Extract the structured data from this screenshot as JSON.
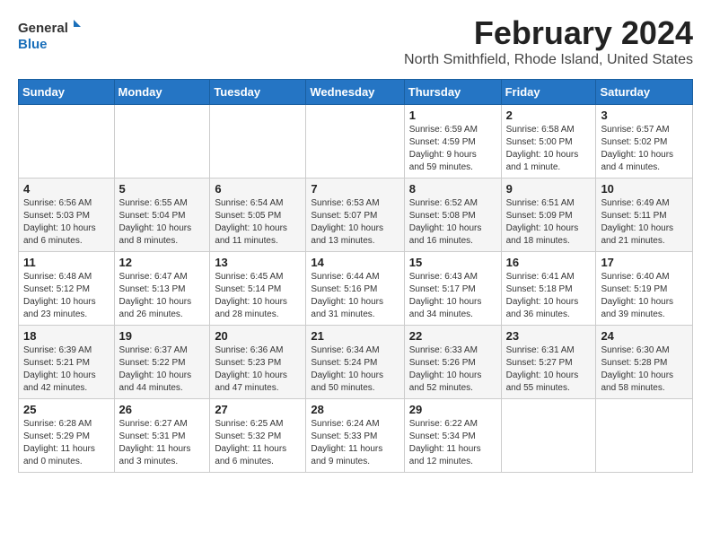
{
  "app": {
    "logo_line1": "General",
    "logo_line2": "Blue"
  },
  "header": {
    "month_year": "February 2024",
    "location": "North Smithfield, Rhode Island, United States"
  },
  "weekdays": [
    "Sunday",
    "Monday",
    "Tuesday",
    "Wednesday",
    "Thursday",
    "Friday",
    "Saturday"
  ],
  "weeks": [
    [
      {
        "day": "",
        "info": ""
      },
      {
        "day": "",
        "info": ""
      },
      {
        "day": "",
        "info": ""
      },
      {
        "day": "",
        "info": ""
      },
      {
        "day": "1",
        "info": "Sunrise: 6:59 AM\nSunset: 4:59 PM\nDaylight: 9 hours\nand 59 minutes."
      },
      {
        "day": "2",
        "info": "Sunrise: 6:58 AM\nSunset: 5:00 PM\nDaylight: 10 hours\nand 1 minute."
      },
      {
        "day": "3",
        "info": "Sunrise: 6:57 AM\nSunset: 5:02 PM\nDaylight: 10 hours\nand 4 minutes."
      }
    ],
    [
      {
        "day": "4",
        "info": "Sunrise: 6:56 AM\nSunset: 5:03 PM\nDaylight: 10 hours\nand 6 minutes."
      },
      {
        "day": "5",
        "info": "Sunrise: 6:55 AM\nSunset: 5:04 PM\nDaylight: 10 hours\nand 8 minutes."
      },
      {
        "day": "6",
        "info": "Sunrise: 6:54 AM\nSunset: 5:05 PM\nDaylight: 10 hours\nand 11 minutes."
      },
      {
        "day": "7",
        "info": "Sunrise: 6:53 AM\nSunset: 5:07 PM\nDaylight: 10 hours\nand 13 minutes."
      },
      {
        "day": "8",
        "info": "Sunrise: 6:52 AM\nSunset: 5:08 PM\nDaylight: 10 hours\nand 16 minutes."
      },
      {
        "day": "9",
        "info": "Sunrise: 6:51 AM\nSunset: 5:09 PM\nDaylight: 10 hours\nand 18 minutes."
      },
      {
        "day": "10",
        "info": "Sunrise: 6:49 AM\nSunset: 5:11 PM\nDaylight: 10 hours\nand 21 minutes."
      }
    ],
    [
      {
        "day": "11",
        "info": "Sunrise: 6:48 AM\nSunset: 5:12 PM\nDaylight: 10 hours\nand 23 minutes."
      },
      {
        "day": "12",
        "info": "Sunrise: 6:47 AM\nSunset: 5:13 PM\nDaylight: 10 hours\nand 26 minutes."
      },
      {
        "day": "13",
        "info": "Sunrise: 6:45 AM\nSunset: 5:14 PM\nDaylight: 10 hours\nand 28 minutes."
      },
      {
        "day": "14",
        "info": "Sunrise: 6:44 AM\nSunset: 5:16 PM\nDaylight: 10 hours\nand 31 minutes."
      },
      {
        "day": "15",
        "info": "Sunrise: 6:43 AM\nSunset: 5:17 PM\nDaylight: 10 hours\nand 34 minutes."
      },
      {
        "day": "16",
        "info": "Sunrise: 6:41 AM\nSunset: 5:18 PM\nDaylight: 10 hours\nand 36 minutes."
      },
      {
        "day": "17",
        "info": "Sunrise: 6:40 AM\nSunset: 5:19 PM\nDaylight: 10 hours\nand 39 minutes."
      }
    ],
    [
      {
        "day": "18",
        "info": "Sunrise: 6:39 AM\nSunset: 5:21 PM\nDaylight: 10 hours\nand 42 minutes."
      },
      {
        "day": "19",
        "info": "Sunrise: 6:37 AM\nSunset: 5:22 PM\nDaylight: 10 hours\nand 44 minutes."
      },
      {
        "day": "20",
        "info": "Sunrise: 6:36 AM\nSunset: 5:23 PM\nDaylight: 10 hours\nand 47 minutes."
      },
      {
        "day": "21",
        "info": "Sunrise: 6:34 AM\nSunset: 5:24 PM\nDaylight: 10 hours\nand 50 minutes."
      },
      {
        "day": "22",
        "info": "Sunrise: 6:33 AM\nSunset: 5:26 PM\nDaylight: 10 hours\nand 52 minutes."
      },
      {
        "day": "23",
        "info": "Sunrise: 6:31 AM\nSunset: 5:27 PM\nDaylight: 10 hours\nand 55 minutes."
      },
      {
        "day": "24",
        "info": "Sunrise: 6:30 AM\nSunset: 5:28 PM\nDaylight: 10 hours\nand 58 minutes."
      }
    ],
    [
      {
        "day": "25",
        "info": "Sunrise: 6:28 AM\nSunset: 5:29 PM\nDaylight: 11 hours\nand 0 minutes."
      },
      {
        "day": "26",
        "info": "Sunrise: 6:27 AM\nSunset: 5:31 PM\nDaylight: 11 hours\nand 3 minutes."
      },
      {
        "day": "27",
        "info": "Sunrise: 6:25 AM\nSunset: 5:32 PM\nDaylight: 11 hours\nand 6 minutes."
      },
      {
        "day": "28",
        "info": "Sunrise: 6:24 AM\nSunset: 5:33 PM\nDaylight: 11 hours\nand 9 minutes."
      },
      {
        "day": "29",
        "info": "Sunrise: 6:22 AM\nSunset: 5:34 PM\nDaylight: 11 hours\nand 12 minutes."
      },
      {
        "day": "",
        "info": ""
      },
      {
        "day": "",
        "info": ""
      }
    ]
  ]
}
